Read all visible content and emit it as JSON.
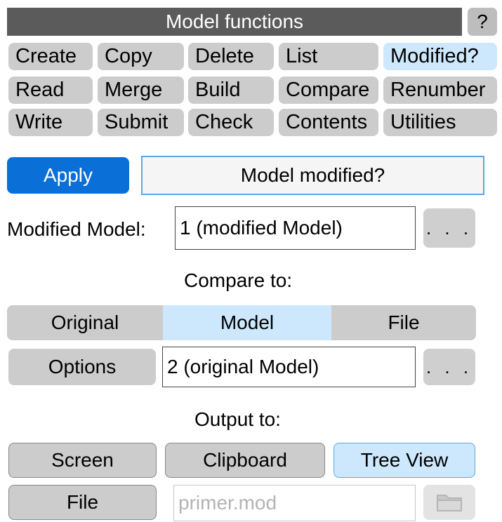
{
  "panel": {
    "title": "Model functions",
    "help_label": "?"
  },
  "functions": [
    {
      "label": "Create",
      "name": "function-create-button"
    },
    {
      "label": "Copy",
      "name": "function-copy-button"
    },
    {
      "label": "Delete",
      "name": "function-delete-button"
    },
    {
      "label": "List",
      "name": "function-list-button"
    },
    {
      "label": "Modified?",
      "name": "function-modified-button",
      "active": true
    },
    {
      "label": "Read",
      "name": "function-read-button"
    },
    {
      "label": "Merge",
      "name": "function-merge-button"
    },
    {
      "label": "Build",
      "name": "function-build-button"
    },
    {
      "label": "Compare",
      "name": "function-compare-button"
    },
    {
      "label": "Renumber",
      "name": "function-renumber-button"
    },
    {
      "label": "Write",
      "name": "function-write-button"
    },
    {
      "label": "Submit",
      "name": "function-submit-button"
    },
    {
      "label": "Check",
      "name": "function-check-button"
    },
    {
      "label": "Contents",
      "name": "function-contents-button"
    },
    {
      "label": "Utilities",
      "name": "function-utilities-button"
    }
  ],
  "apply": {
    "label": "Apply",
    "mode_title": "Model modified?"
  },
  "modified_model": {
    "label": "Modified Model:",
    "value": "1 (modified Model)",
    "browse_label": ". . ."
  },
  "compare": {
    "heading": "Compare to:",
    "segments": [
      "Original",
      "Model",
      "File"
    ],
    "selected": "Model",
    "options_label": "Options",
    "value": "2 (original Model)",
    "browse_label": ". . ."
  },
  "output": {
    "heading": "Output to:",
    "screen_label": "Screen",
    "clipboard_label": "Clipboard",
    "tree_view_label": "Tree View",
    "selected": "Tree View",
    "file_label": "File",
    "file_placeholder": "primer.mod",
    "folder_icon": "folder-icon"
  }
}
